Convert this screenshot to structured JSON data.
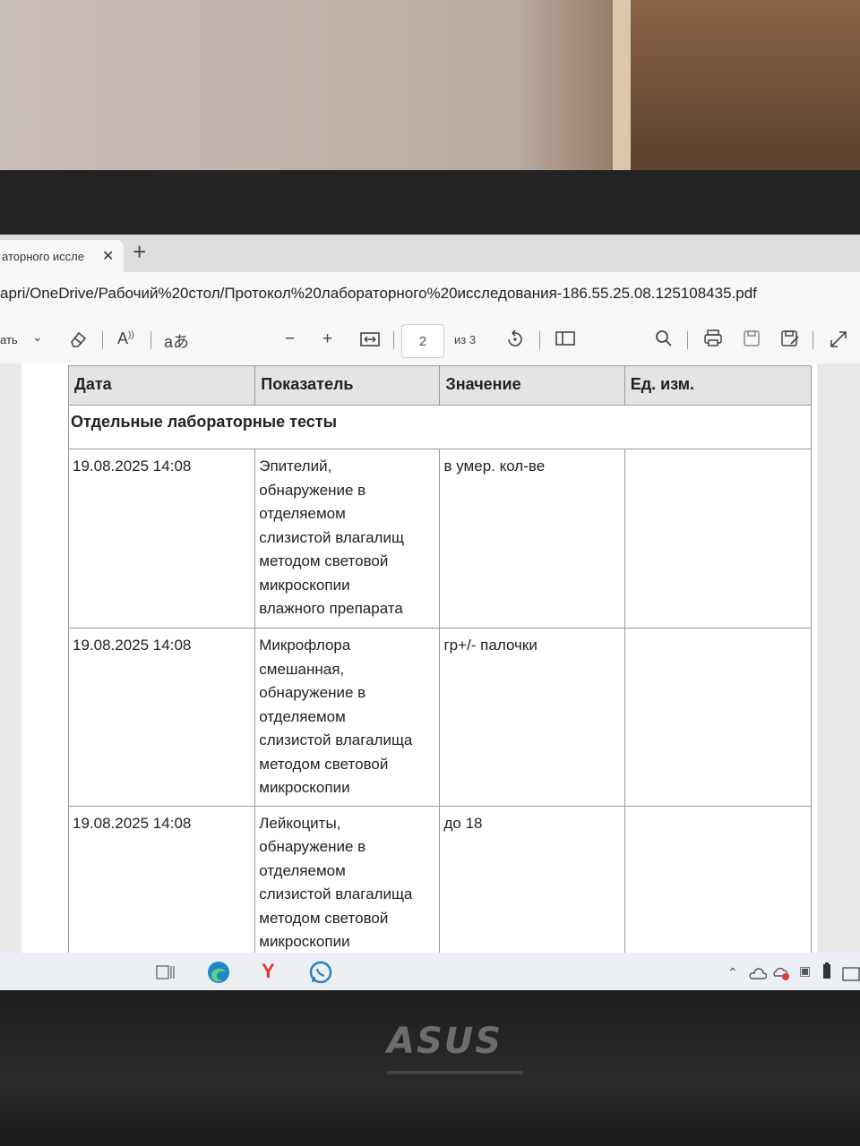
{
  "browser": {
    "tab_title": "аторного иссле",
    "tab_close": "✕",
    "new_tab": "+",
    "url": "apri/OneDrive/Рабочий%20стол/Протокол%20лабораторного%20исследования-186.55.25.08.125108435.pdf"
  },
  "pdf_toolbar": {
    "draw_label": "ать",
    "chevron": "⌄",
    "zoom_out": "−",
    "zoom_in": "+",
    "page_current": "2",
    "page_total": "из 3"
  },
  "table": {
    "headers": [
      "Дата",
      "Показатель",
      "Значение",
      "Ед. изм."
    ],
    "section": "Отдельные лабораторные тесты",
    "rows": [
      {
        "date": "19.08.2025 14:08",
        "indicator": [
          "Эпителий,",
          "обнаружение в",
          "отделяемом",
          "слизистой влагалищ",
          "методом световой",
          "микроскопии",
          "влажного препарата"
        ],
        "value": "в умер. кол-ве",
        "unit": ""
      },
      {
        "date": "19.08.2025 14:08",
        "indicator": [
          "Микрофлора",
          "смешанная,",
          "обнаружение в",
          "отделяемом",
          "слизистой влагалища",
          "методом световой",
          "микроскопии"
        ],
        "value": "гр+/- палочки",
        "unit": ""
      },
      {
        "date": "19.08.2025 14:08",
        "indicator": [
          "Лейкоциты,",
          "обнаружение в",
          "отделяемом",
          "слизистой влагалища",
          "методом световой",
          "микроскопии"
        ],
        "value": "до 18",
        "unit": ""
      }
    ]
  },
  "laptop": {
    "brand": "ASUS"
  },
  "colors": {
    "edge_blue": "#1e88c9",
    "yandex_red": "#e53935",
    "whatsapp_blue": "#2b7fc0"
  }
}
